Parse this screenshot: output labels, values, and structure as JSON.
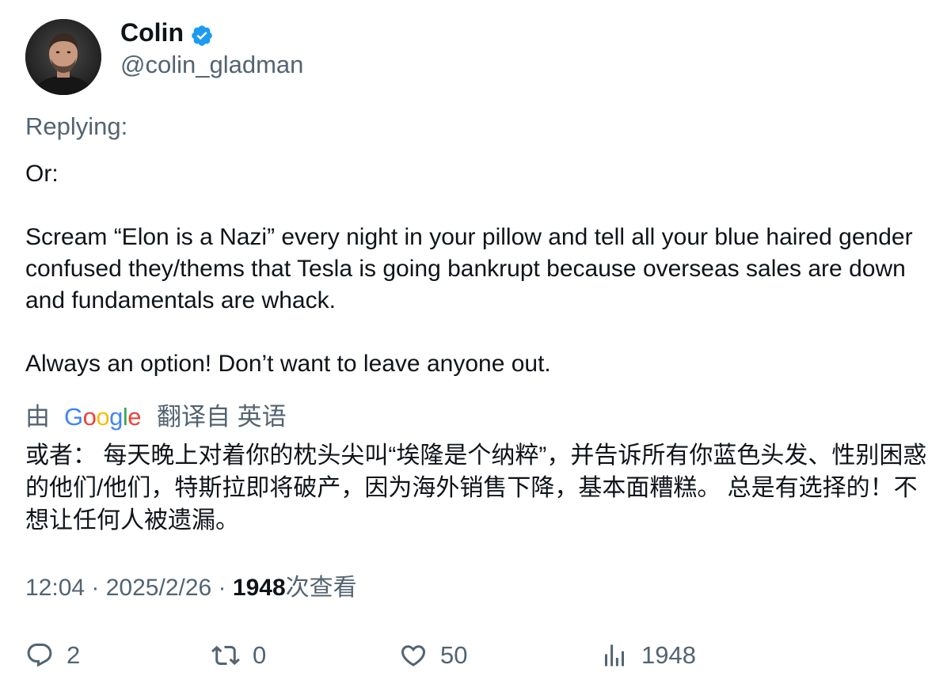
{
  "author": {
    "display_name": "Colin",
    "handle": "@colin_gladman",
    "verified": true,
    "verified_color": "#1d9bf0"
  },
  "replying_label": "Replying:",
  "tweet": {
    "paragraphs": [
      "Or:",
      "Scream “Elon is a Nazi” every night in your pillow and tell all your blue haired gender confused they/thems that Tesla is going bankrupt because overseas sales are down and fundamentals are whack.",
      "Always an option! Don’t want to leave anyone out."
    ]
  },
  "translation": {
    "prefix": "由",
    "provider": "Google",
    "suffix": "翻译自 英语",
    "text": "或者： 每天晚上对着你的枕头尖叫“埃隆是个纳粹”，并告诉所有你蓝色头发、性别困惑的他们/他们，特斯拉即将破产，因为海外销售下降，基本面糟糕。 总是有选择的！不想让任何人被遗漏。"
  },
  "meta": {
    "time": "12:04",
    "separator": " · ",
    "date": "2025/2/26",
    "views_count": "1948",
    "views_label": "次查看"
  },
  "actions": {
    "reply_count": "2",
    "retweet_count": "0",
    "like_count": "50",
    "views_count": "1948"
  },
  "colors": {
    "text_primary": "#0f1419",
    "text_secondary": "#536471",
    "verified_blue": "#1d9bf0"
  },
  "icons": {
    "reply": "reply-icon",
    "retweet": "retweet-icon",
    "like": "heart-icon",
    "views": "views-bar-chart-icon"
  }
}
